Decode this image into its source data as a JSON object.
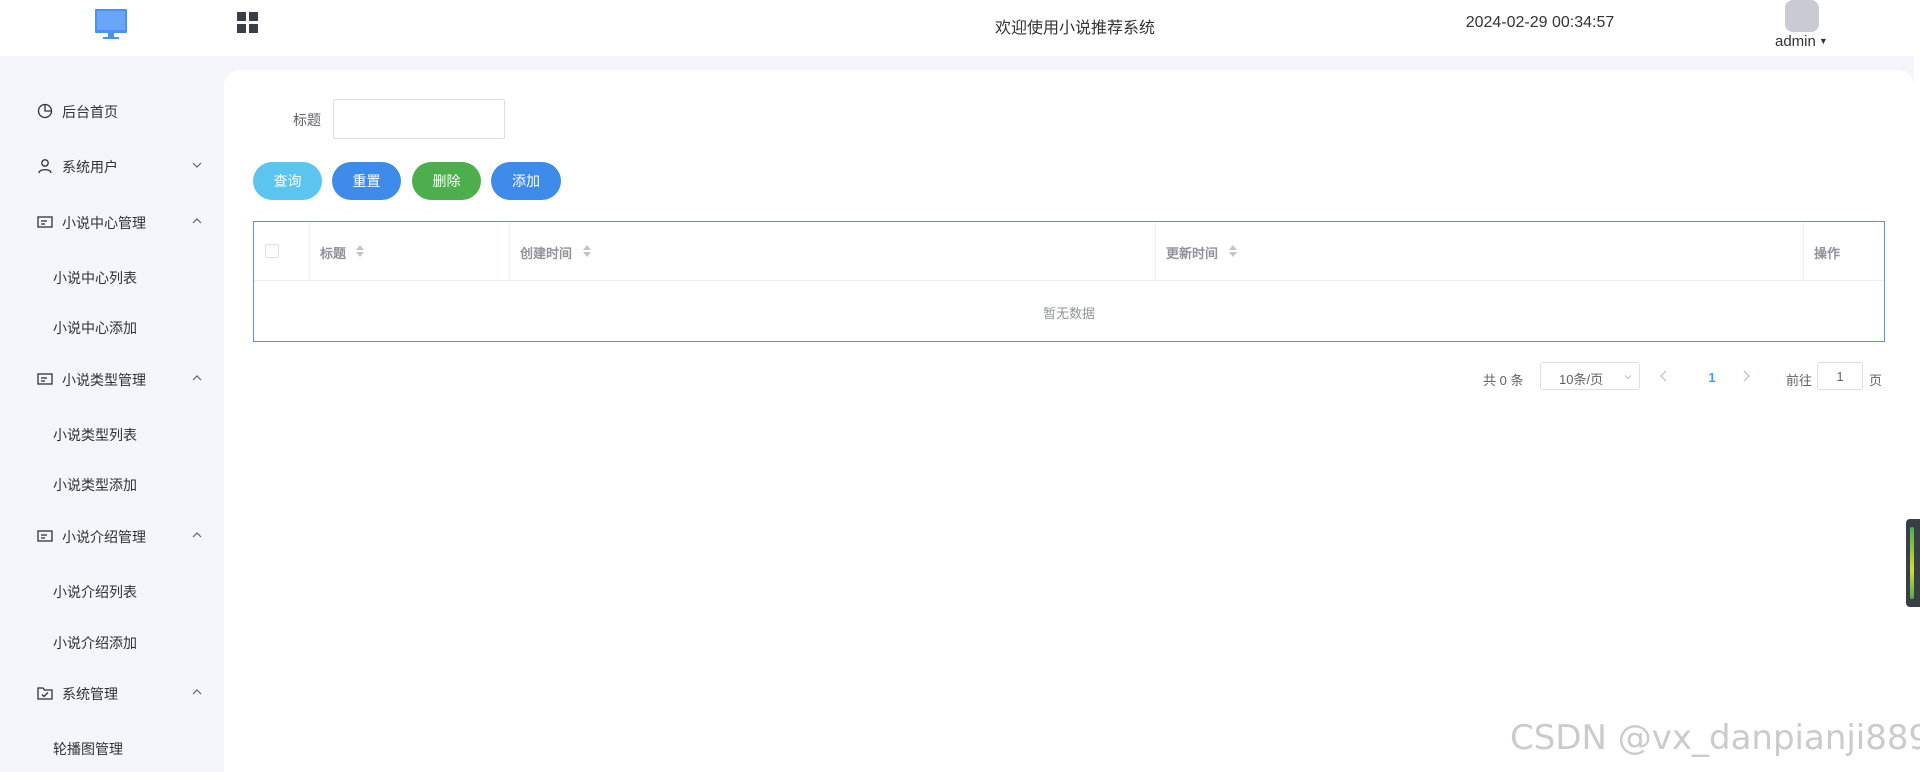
{
  "header": {
    "title": "欢迎使用小说推荐系统",
    "datetime": "2024-02-29 00:34:57",
    "user": "admin"
  },
  "sidebar": {
    "items": [
      {
        "label": "后台首页",
        "icon": "pie-chart-icon"
      },
      {
        "label": "系统用户",
        "icon": "user-icon",
        "expanded": false
      },
      {
        "label": "小说中心管理",
        "icon": "card-icon",
        "expanded": true,
        "children": [
          {
            "label": "小说中心列表"
          },
          {
            "label": "小说中心添加"
          }
        ]
      },
      {
        "label": "小说类型管理",
        "icon": "card-icon",
        "expanded": true,
        "children": [
          {
            "label": "小说类型列表"
          },
          {
            "label": "小说类型添加"
          }
        ]
      },
      {
        "label": "小说介绍管理",
        "icon": "card-icon",
        "expanded": true,
        "children": [
          {
            "label": "小说介绍列表"
          },
          {
            "label": "小说介绍添加"
          }
        ]
      },
      {
        "label": "系统管理",
        "icon": "folder-check-icon",
        "expanded": true,
        "children": [
          {
            "label": "轮播图管理"
          }
        ]
      }
    ]
  },
  "filter": {
    "title_label": "标题",
    "title_value": ""
  },
  "actions": {
    "query": "查询",
    "reset": "重置",
    "delete": "删除",
    "add": "添加"
  },
  "table": {
    "columns": [
      "标题",
      "创建时间",
      "更新时间",
      "操作"
    ],
    "rows": [],
    "empty_text": "暂无数据"
  },
  "pagination": {
    "total": "共 0 条",
    "page_size": "10条/页",
    "current_page": "1",
    "goto_label": "前往",
    "goto_value": "1",
    "goto_suffix": "页"
  },
  "watermark": "CSDN @vx_danpianji889",
  "colors": {
    "primary": "#3f8bea",
    "query": "#5bc4ef",
    "delete": "#4cae4c",
    "sidebar_bg": "#f3f5fb",
    "active_page": "#409eff"
  }
}
